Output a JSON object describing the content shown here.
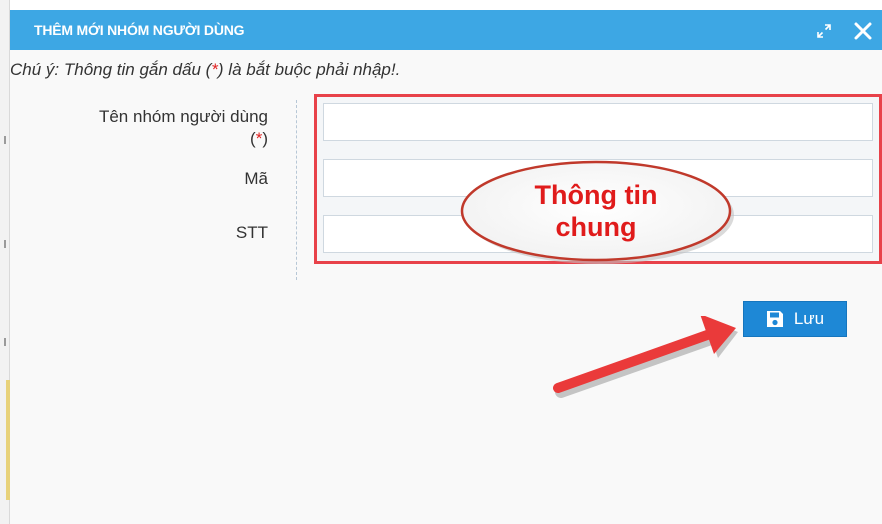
{
  "dialog": {
    "title": "THÊM MỚI NHÓM NGƯỜI DÙNG",
    "expand_icon": "expand-icon",
    "close_icon": "close-icon",
    "note_prefix": "Chú ý: Thông tin gắn dấu (",
    "note_star": "*",
    "note_suffix": ") là bắt buộc phải nhập!."
  },
  "form": {
    "labels": {
      "group_name": "Tên nhóm người dùng",
      "required_open": "(",
      "required_star": "*",
      "required_close": ")",
      "code": "Mã",
      "order": "STT"
    },
    "values": {
      "group_name": "",
      "code": "",
      "order": ""
    }
  },
  "callout": {
    "line1": "Thông tin",
    "line2": "chung"
  },
  "actions": {
    "save_label": "Lưu",
    "save_icon": "floppy-disk-icon"
  },
  "colors": {
    "titlebar": "#3da7e4",
    "highlight_red": "#e8424a",
    "button_blue": "#1e88d6",
    "required_red": "#e02020"
  }
}
